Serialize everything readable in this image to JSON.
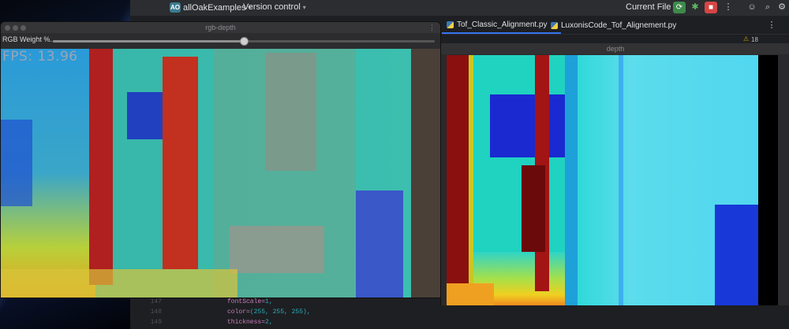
{
  "ide": {
    "project_badge": "AO",
    "project_name": "allOakExamples",
    "vcs_label": "Version control",
    "run_config": "Current File",
    "tabs": [
      {
        "label": "Tof_Classic_Alignment.py",
        "active": true
      },
      {
        "label": "LuxonisCode_Tof_Alignement.py",
        "active": false
      }
    ],
    "warnings": {
      "icon": "warning-icon",
      "count": "18"
    },
    "code_lines": [
      {
        "num": "147",
        "key": "fontScale=",
        "value": "1,"
      },
      {
        "num": "148",
        "key": "color=",
        "value": "(255, 255, 255),"
      },
      {
        "num": "149",
        "key": "thickness=",
        "value": "2,"
      }
    ],
    "colors": {
      "accent": "#3574f0",
      "run_green": "#3d8a4a",
      "stop_red": "#d64545"
    }
  },
  "rgb_window": {
    "title": "rgb-depth",
    "slider_label": "RGB Weight %...",
    "slider_value_fraction": 0.5,
    "fps_text": "FPS: 13.96"
  },
  "depth_window": {
    "title": "depth"
  }
}
